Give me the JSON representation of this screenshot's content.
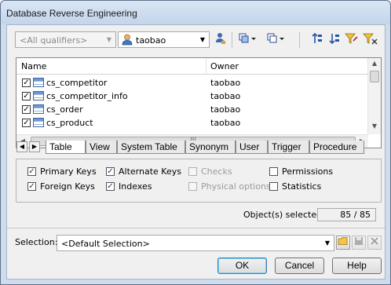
{
  "window": {
    "title": "Database Reverse Engineering"
  },
  "toolbar": {
    "qualifier_placeholder": "<All qualifiers>",
    "owner_value": "taobao",
    "icons": [
      "user-select-icon",
      "select-all-icon",
      "deselect-all-icon",
      "sort-ascending-icon",
      "sort-descending-icon",
      "filter-icon",
      "clear-filter-icon"
    ]
  },
  "list": {
    "columns": [
      "Name",
      "Owner"
    ],
    "rows": [
      {
        "checked": true,
        "name": "cs_competitor",
        "owner": "taobao"
      },
      {
        "checked": true,
        "name": "cs_competitor_info",
        "owner": "taobao"
      },
      {
        "checked": true,
        "name": "cs_order",
        "owner": "taobao"
      },
      {
        "checked": true,
        "name": "cs_product",
        "owner": "taobao"
      }
    ],
    "hscroll_grip": "III"
  },
  "tabs": [
    "Table",
    "View",
    "System Table",
    "Synonym",
    "User",
    "Trigger",
    "Procedure"
  ],
  "active_tab": "Table",
  "options": {
    "primary_keys": {
      "label": "Primary Keys",
      "checked": true
    },
    "foreign_keys": {
      "label": "Foreign Keys",
      "checked": true
    },
    "alternate_keys": {
      "label": "Alternate Keys",
      "checked": true
    },
    "indexes": {
      "label": "Indexes",
      "checked": true
    },
    "checks": {
      "label": "Checks",
      "checked": false,
      "disabled": true
    },
    "physical_options": {
      "label": "Physical options",
      "checked": false,
      "disabled": true
    },
    "permissions": {
      "label": "Permissions",
      "checked": false
    },
    "statistics": {
      "label": "Statistics",
      "checked": false
    }
  },
  "status": {
    "label": "Object(s) selected:",
    "count": "85 / 85"
  },
  "selection": {
    "label": "Selection:",
    "value": "<Default Selection>"
  },
  "buttons": {
    "ok": "OK",
    "cancel": "Cancel",
    "help": "Help"
  }
}
